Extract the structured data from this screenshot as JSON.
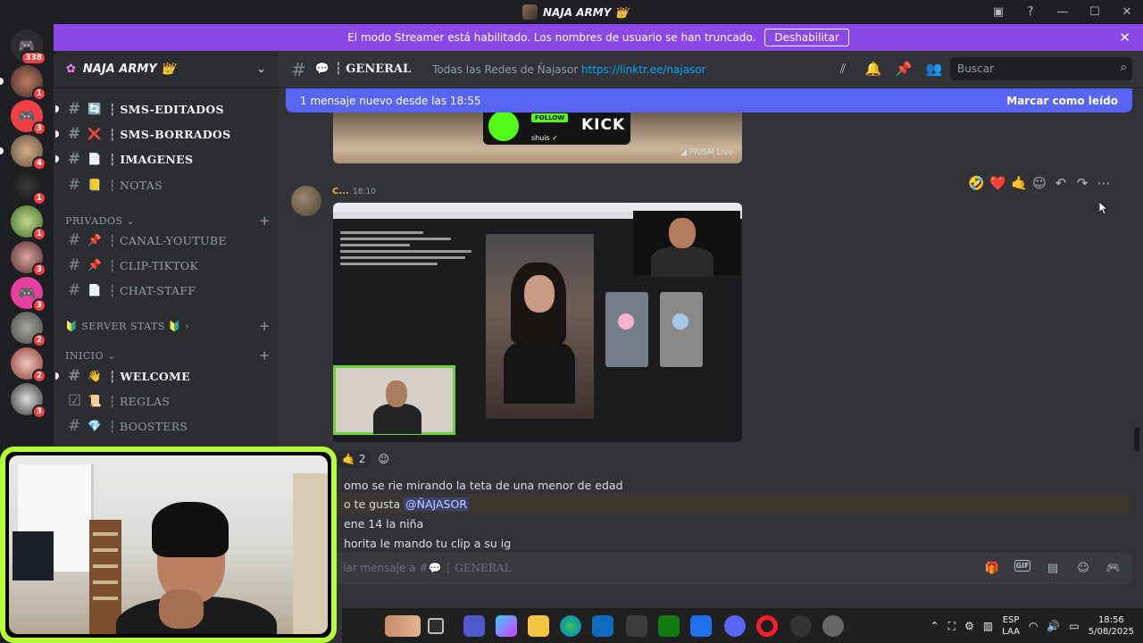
{
  "window": {
    "title": "NAJA ARMY 👑"
  },
  "rail": {
    "home_badge": "338",
    "server_badges": [
      "1",
      "3",
      "4",
      "1",
      "1",
      "3",
      "3",
      "2",
      "2",
      "3"
    ]
  },
  "banner": {
    "text": "El modo Streamer está habilitado. Los nombres de usuario se han truncado.",
    "button": "Deshabilitar"
  },
  "server": {
    "name": "NAJA ARMY 👑"
  },
  "sidebar": {
    "channels_top": [
      {
        "name": "┆ SMS-EDITADOS",
        "emoji": "🔄"
      },
      {
        "name": "┆ SMS-BORRADOS",
        "emoji": "❌"
      },
      {
        "name": "┆ IMAGENES",
        "emoji": "📄"
      },
      {
        "name": "┆ NOTAS",
        "emoji": "📒"
      }
    ],
    "cat_privados": "PRIVADOS ⌄",
    "channels_privados": [
      {
        "name": "┆ CANAL-YOUTUBE",
        "emoji": "📌"
      },
      {
        "name": "┆ CLIP-TIKTOK",
        "emoji": "📌"
      },
      {
        "name": "┆ CHAT-STAFF",
        "emoji": "📄"
      }
    ],
    "cat_stats": "🔰 SERVER STATS 🔰 ›",
    "cat_inicio": "INICIO ⌄",
    "channels_inicio": [
      {
        "name": "┆ WELCOME",
        "emoji": "👋"
      },
      {
        "name": "┆ REGLAS",
        "emoji": "📜"
      },
      {
        "name": "┆ BOOSTERS",
        "emoji": "💎"
      }
    ]
  },
  "chat_header": {
    "channel": "┆ GENERAL",
    "topic": "Todas las Redes de Ñajasor",
    "link": "https://linktr.ee/najasor",
    "search_placeholder": "Buscar"
  },
  "new_messages": {
    "text": "1 mensaje nuevo desde las 18:55",
    "action": "Marcar como leído"
  },
  "embed_top": {
    "follow": "FOLLOW",
    "kick": "KICK",
    "user": "shuis ✓",
    "prism": "◢ PRISM Live"
  },
  "message": {
    "author": "C...",
    "time": "18:10",
    "reaction_count": "2"
  },
  "lines": [
    "omo se rie mirando la teta de una menor de edad",
    "o te gusta",
    "ene 14 la niña",
    "horita le mando tu clip a su ig"
  ],
  "mention": "@ÑAJASOR",
  "composer": {
    "placeholder_prefix": "iar mensaje a #💬 ┆ ",
    "placeholder_channel": "GENERAL"
  },
  "tray": {
    "lang1": "ESP",
    "lang2": "LAA",
    "time": "18:56",
    "date": "5/08/2025"
  },
  "colors": {
    "banner": "#8c47e8",
    "accent": "#5865f2",
    "webcam_border": "#b4ff39"
  }
}
